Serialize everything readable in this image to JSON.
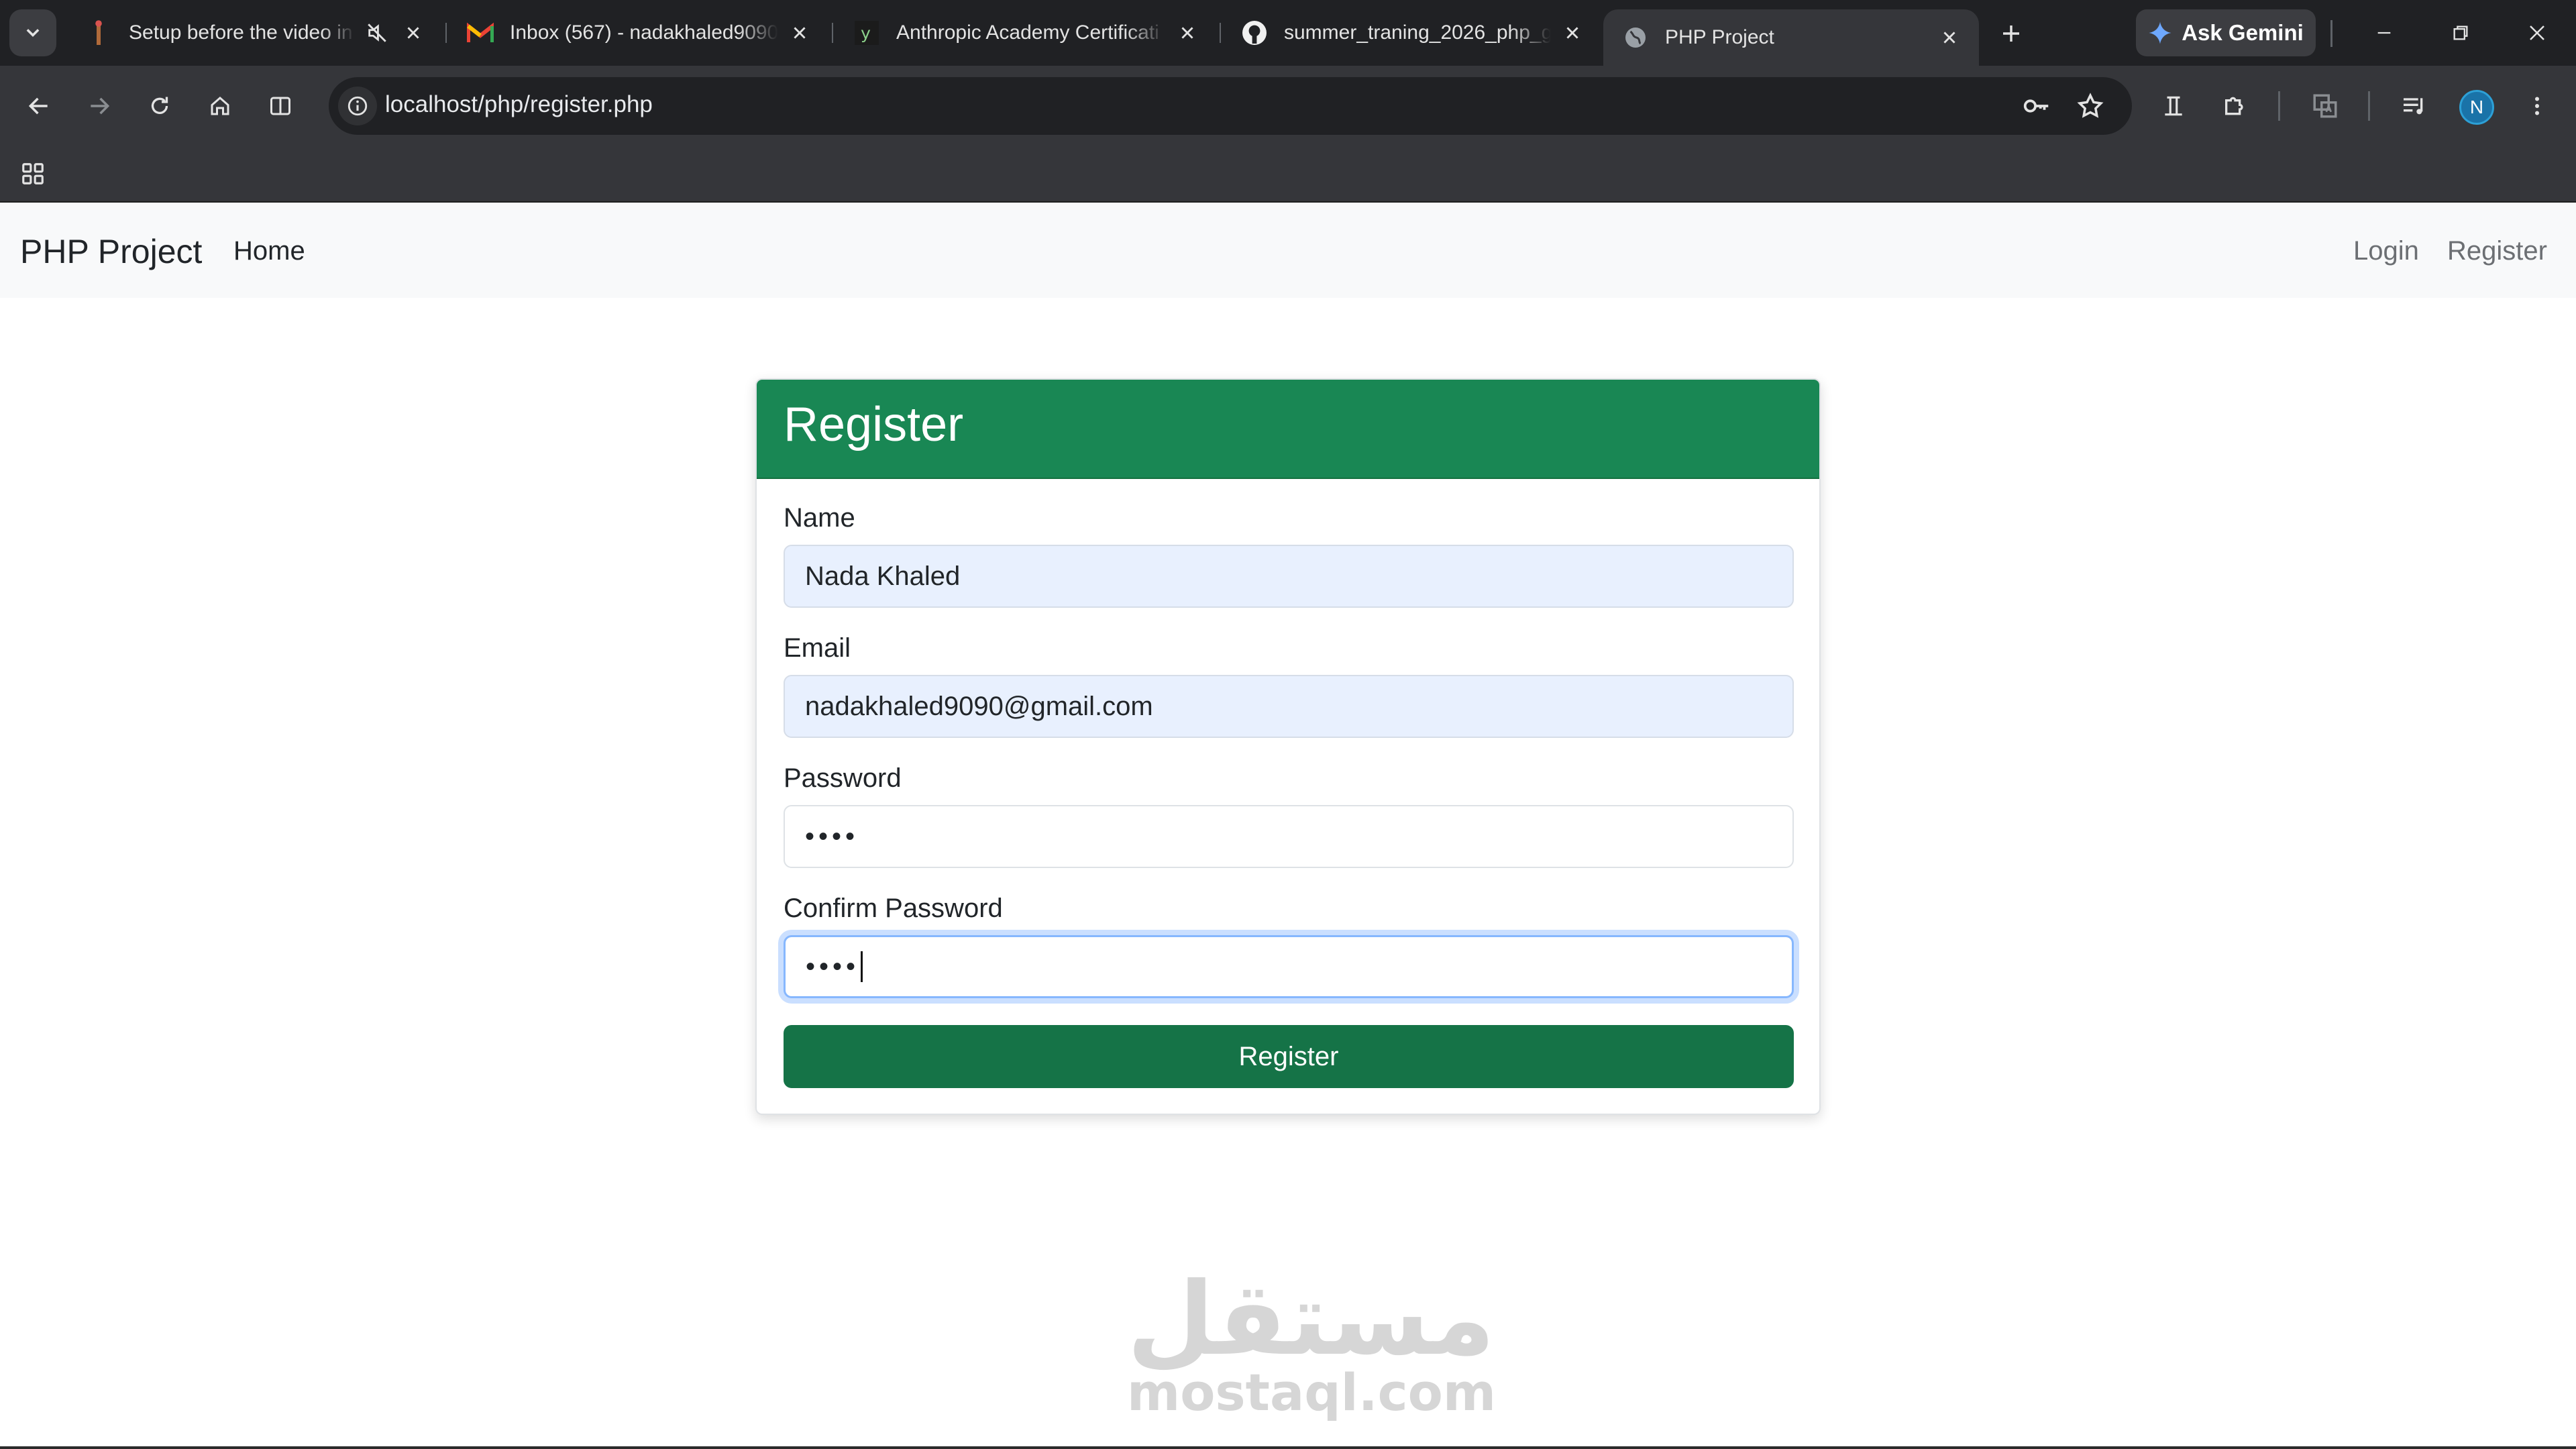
{
  "browser": {
    "tabs": [
      {
        "title": "Setup before the video in",
        "icon": "video-tab-icon",
        "muted": true
      },
      {
        "title": "Inbox (567) - nadakhaled9090",
        "icon": "gmail-icon"
      },
      {
        "title": "Anthropic Academy Certificati",
        "icon": "y-icon"
      },
      {
        "title": "summer_traning_2026_php_g",
        "icon": "github-icon"
      },
      {
        "title": "PHP Project",
        "icon": "globe-icon",
        "active": true
      }
    ],
    "gemini_label": "Ask Gemini",
    "url": "localhost/php/register.php",
    "profile_initial": "N"
  },
  "navbar": {
    "brand": "PHP Project",
    "home": "Home",
    "login": "Login",
    "register": "Register"
  },
  "form": {
    "title": "Register",
    "name_label": "Name",
    "name_value": "Nada Khaled",
    "email_label": "Email",
    "email_value": "nadakhaled9090@gmail.com",
    "password_label": "Password",
    "password_mask": "••••",
    "confirm_label": "Confirm Password",
    "confirm_mask": "••••",
    "submit_label": "Register"
  },
  "watermark": {
    "arabic": "مستقل",
    "latin": "mostaql.com"
  },
  "colors": {
    "header_green": "#198754",
    "button_green": "#157347",
    "autofill_bg": "#e8f0fe",
    "chrome_dark": "#202124"
  }
}
